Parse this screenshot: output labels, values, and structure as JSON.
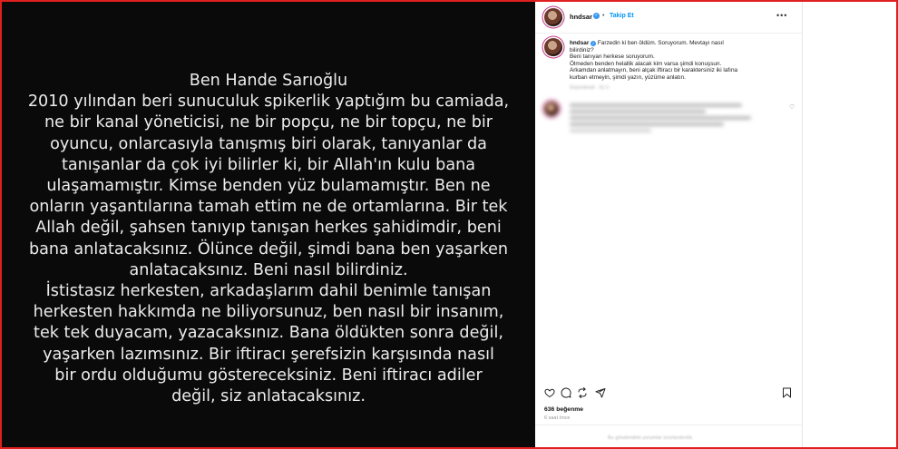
{
  "story": {
    "lines": [
      "Ben Hande Sarıoğlu",
      "2010 yılından beri sunuculuk spikerlik yaptığım bu camiada,",
      "ne bir kanal yöneticisi, ne bir popçu, ne bir topçu, ne bir",
      "oyuncu, onlarcasıyla tanışmış biri olarak, tanıyanlar da",
      "tanışanlar da çok iyi bilirler ki, bir Allah'ın kulu bana",
      "ulaşamamıştır. Kimse benden yüz bulamamıştır. Ben ne",
      "onların yaşantılarına tamah ettim ne de ortamlarına. Bir tek",
      "Allah değil, şahsen tanıyıp tanışan herkes şahidimdir, beni",
      "bana anlatacaksınız. Ölünce değil, şimdi bana ben yaşarken",
      "anlatacaksınız. Beni nasıl bilirdiniz.",
      "İstistasız herkesten, arkadaşlarım dahil benimle tanışan",
      "herkesten hakkımda ne biliyorsunuz, ben nasıl bir insanım,",
      "tek tek duyacam, yazacaksınız. Bana öldükten sonra değil,",
      "yaşarken lazımsınız. Bir iftiracı şerefsizin karşısında nasıl",
      "bir ordu olduğumu göstereceksiniz. Beni iftiracı adiler",
      "değil, siz anlatacaksınız."
    ]
  },
  "post": {
    "username": "hndsar",
    "separator": "•",
    "follow_label": "Takip Et",
    "more_label": "•••",
    "caption": {
      "username": "hndsar",
      "lines": [
        "Farzedin ki ben öldüm. Soruyorum. Mevtayı nasıl",
        "bilirdiniz?",
        "Beni tanıyan herkese soruyorum.",
        "Ölmeden benden helallik alacak kim varsa şimdi konuşsun.",
        "Arkamdan anlatmayın, beni alçak iftiracı bir karaktersiniz iki lafına",
        "kurban etmeyin, şimdi yazın, yüzüme anlatın."
      ]
    },
    "caption_meta": "Düzenlendi · 31 h",
    "likes": "636 beğenme",
    "time_ago": "6 saat önce",
    "add_comment_placeholder": "Bu gönderideki yorumlar sınırlandırıldı.",
    "icons": {
      "like": "heart-icon",
      "comment": "comment-icon",
      "share": "share-icon",
      "save": "bookmark-icon"
    },
    "colors": {
      "accent": "#0095f6",
      "verified": "#3897f0",
      "frame_border": "#e0201f",
      "story_bg": "#0a0a0a"
    }
  }
}
